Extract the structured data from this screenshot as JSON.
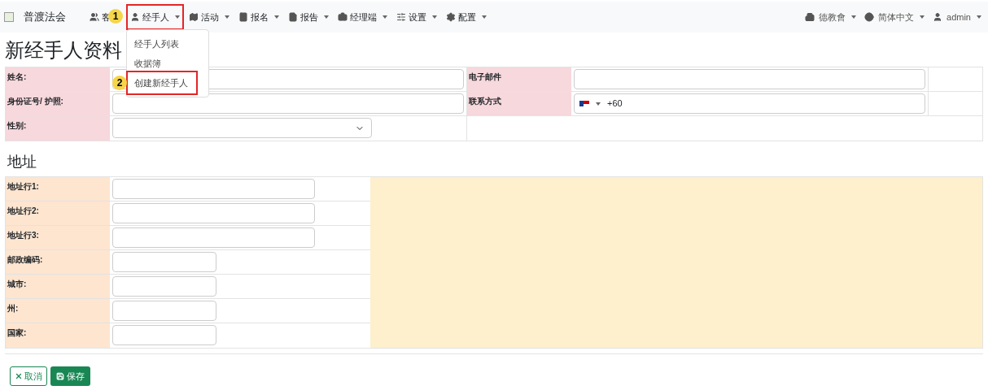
{
  "navbar": {
    "brand": "普渡法会",
    "menus": [
      {
        "label": "客",
        "highlighted": false,
        "badge": "1"
      },
      {
        "label": "经手人",
        "highlighted": true
      },
      {
        "label": "活动",
        "highlighted": false
      },
      {
        "label": "报名",
        "highlighted": false
      },
      {
        "label": "报告",
        "highlighted": false
      },
      {
        "label": "经理端",
        "highlighted": false
      },
      {
        "label": "设置",
        "highlighted": false
      },
      {
        "label": "配置",
        "highlighted": false
      }
    ],
    "right_menus": [
      {
        "label": "德教會"
      },
      {
        "label": "简体中文"
      },
      {
        "label": "admin"
      }
    ],
    "dropdown": {
      "items": [
        {
          "label": "经手人列表",
          "highlighted": false
        },
        {
          "label": "收据簿",
          "highlighted": false
        },
        {
          "label": "创建新经手人",
          "highlighted": true,
          "badge": "2"
        }
      ]
    }
  },
  "page_title": "新经手人资料",
  "personal_rows": [
    [
      {
        "label": "姓名:",
        "kind": "text"
      },
      {
        "label": "电子邮件",
        "kind": "text"
      }
    ],
    [
      {
        "label": "身份证号/ 护照:",
        "kind": "text"
      },
      {
        "label": "联系方式",
        "kind": "phone",
        "value": "+60"
      }
    ],
    [
      {
        "label": "性别:",
        "kind": "select"
      }
    ]
  ],
  "address_title": "地址",
  "address_rows": [
    {
      "label": "地址行1:",
      "kind": "wide"
    },
    {
      "label": "地址行2:",
      "kind": "wide"
    },
    {
      "label": "地址行3:",
      "kind": "wide"
    },
    {
      "label": "邮政编码:",
      "kind": "short"
    },
    {
      "label": "城市:",
      "kind": "short"
    },
    {
      "label": "州:",
      "kind": "short"
    },
    {
      "label": "国家:",
      "kind": "short"
    }
  ],
  "buttons": [
    {
      "label": "取消",
      "kind": "cancel"
    },
    {
      "label": "保存",
      "kind": "save"
    }
  ]
}
